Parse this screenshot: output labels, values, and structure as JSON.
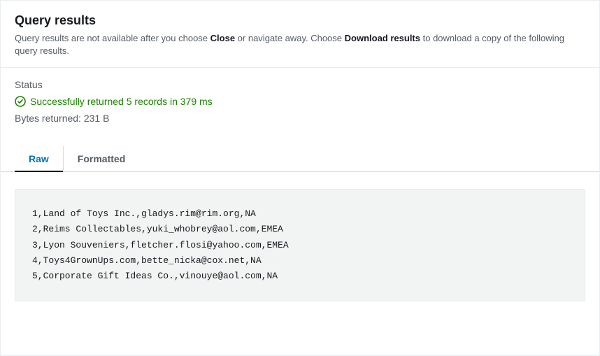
{
  "header": {
    "title": "Query results",
    "subtitle_prefix": "Query results are not available after you choose ",
    "close_word": "Close",
    "subtitle_mid": " or navigate away. Choose ",
    "download_word": "Download results",
    "subtitle_suffix": " to download a copy of the following query results."
  },
  "status": {
    "label": "Status",
    "success_message": "Successfully returned 5 records in 379 ms",
    "bytes_message": "Bytes returned: 231 B"
  },
  "tabs": {
    "raw": "Raw",
    "formatted": "Formatted"
  },
  "results": {
    "rows": [
      "1,Land of Toys Inc.,gladys.rim@rim.org,NA",
      "2,Reims Collectables,yuki_whobrey@aol.com,EMEA",
      "3,Lyon Souveniers,fletcher.flosi@yahoo.com,EMEA",
      "4,Toys4GrownUps.com,bette_nicka@cox.net,NA",
      "5,Corporate Gift Ideas Co.,vinouye@aol.com,NA"
    ]
  }
}
